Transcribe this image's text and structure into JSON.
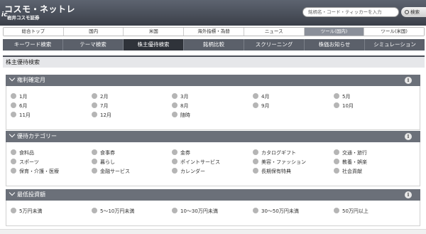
{
  "header": {
    "logo_main": "コスモ・ネットレ",
    "logo_mark": "ic",
    "logo_sub": "岩井コスモ証券",
    "search_placeholder": "銘柄名・コード・ティッカーを入力",
    "search_button": "検索"
  },
  "nav1": [
    "総合トップ",
    "国内",
    "米国",
    "海外指標・為替",
    "ニュース",
    "ツール(国内)",
    "ツール(米国)"
  ],
  "nav1_active": 5,
  "nav2": [
    "キーワード検索",
    "テーマ検索",
    "株主優待検索",
    "銘柄比較",
    "スクリーニング",
    "株価お知らせ",
    "シミュレーション"
  ],
  "nav2_active": 2,
  "page_title": "株主優待検索",
  "sections": {
    "kenri": {
      "title": "権利確定月",
      "options": [
        "1月",
        "2月",
        "3月",
        "4月",
        "5月",
        "6月",
        "7月",
        "8月",
        "9月",
        "10月",
        "11月",
        "12月",
        "随時"
      ]
    },
    "category": {
      "title": "優待カテゴリー",
      "options": [
        "食料品",
        "食事券",
        "金券",
        "カタログギフト",
        "交通・旅行",
        "スポーツ",
        "暮らし",
        "ポイントサービス",
        "美容・ファッション",
        "教養・娯楽",
        "保育・介護・医療",
        "金融サービス",
        "カレンダー",
        "長期保有特典",
        "社会貢献"
      ]
    },
    "investment": {
      "title": "最低投資額",
      "options": [
        "5万円未満",
        "5〜10万円未満",
        "10〜30万円未満",
        "30〜50万円未満",
        "50万円以上"
      ]
    }
  },
  "info_label": "i",
  "colors": {
    "header_bg": "#3b4049",
    "nav_active": "#2f333a",
    "section_head": "#6b7079",
    "radio": "#b5b5b5"
  }
}
